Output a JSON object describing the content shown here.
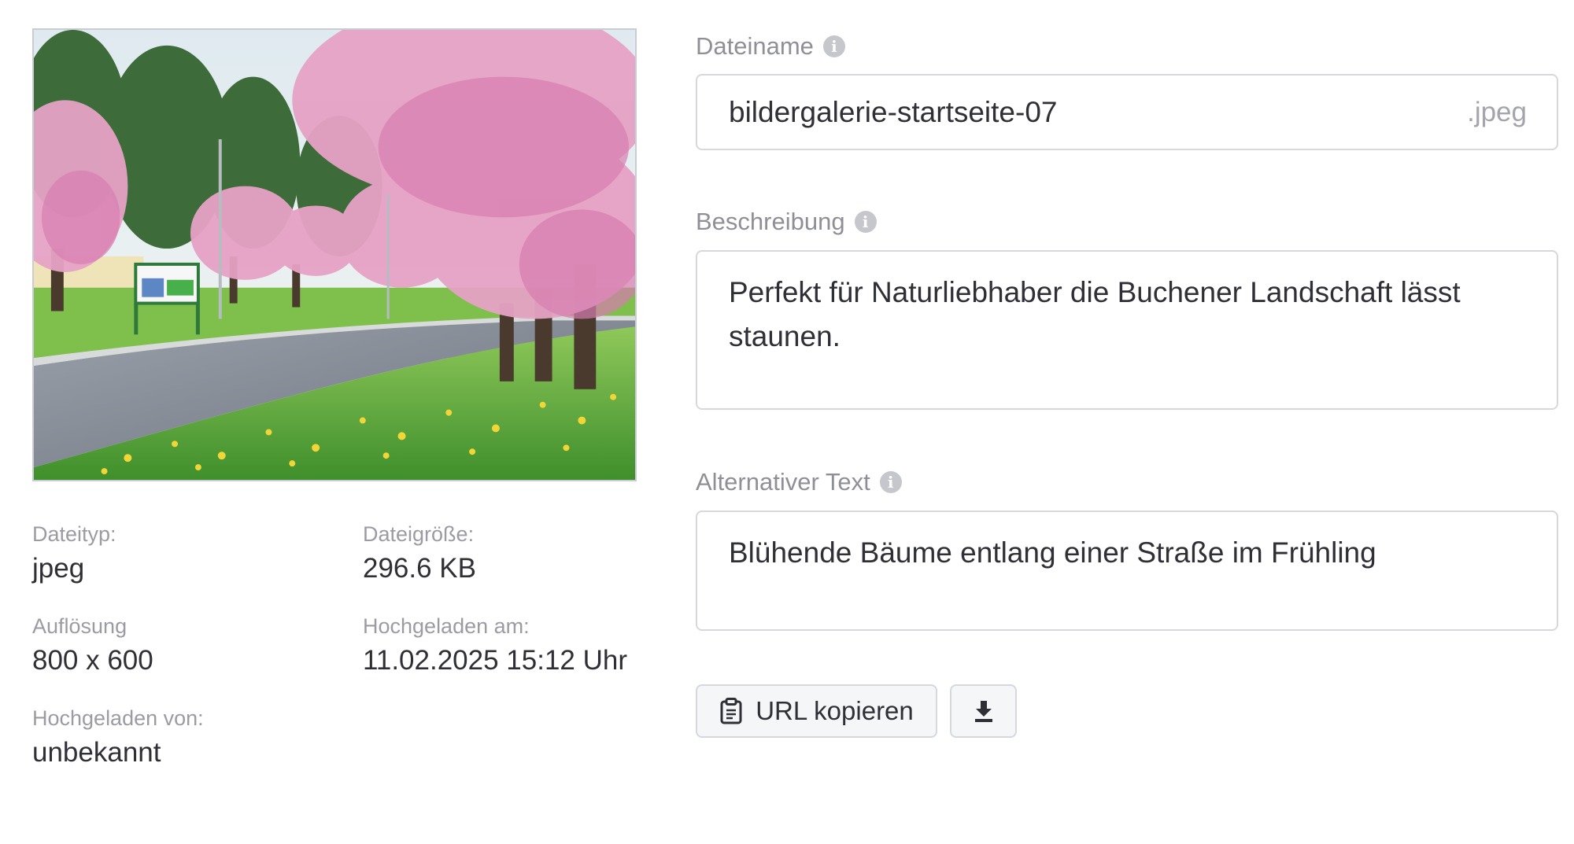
{
  "preview": {
    "icon": "image-preview"
  },
  "meta": {
    "filetype_label": "Dateityp:",
    "filetype_value": "jpeg",
    "filesize_label": "Dateigröße:",
    "filesize_value": "296.6 KB",
    "resolution_label": "Auflösung",
    "resolution_value": "800 x 600",
    "uploaded_at_label": "Hochgeladen am:",
    "uploaded_at_value": "11.02.2025 15:12 Uhr",
    "uploaded_by_label": "Hochgeladen von:",
    "uploaded_by_value": "unbekannt"
  },
  "form": {
    "filename_label": "Dateiname",
    "filename_value": "bildergalerie-startseite-07",
    "filename_suffix": ".jpeg",
    "description_label": "Beschreibung",
    "description_value": "Perfekt für Naturliebhaber die Buchener Landschaft lässt staunen.",
    "alt_label": "Alternativer Text",
    "alt_value": "Blühende Bäume entlang einer Straße im Frühling",
    "info_icon": "info-icon",
    "info_glyph": "i"
  },
  "actions": {
    "copy_url_label": "URL kopieren",
    "copy_icon": "clipboard-icon",
    "download_icon": "download-icon"
  },
  "colors": {
    "label": "#8f9097",
    "text": "#2f2f36",
    "border": "#d6d8de",
    "button_bg": "#f5f6f8",
    "info_icon": "#c6c7cd"
  }
}
